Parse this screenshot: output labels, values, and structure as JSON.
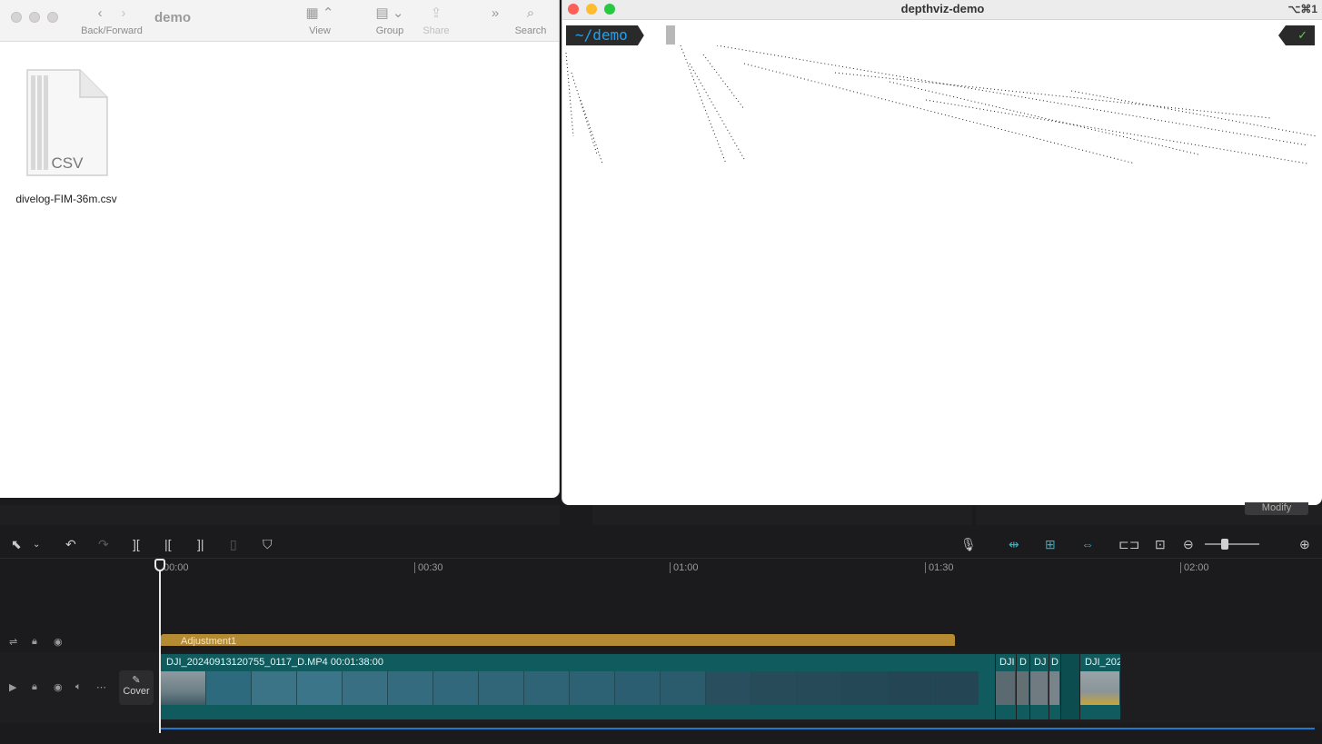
{
  "finder": {
    "title": "demo",
    "toolbar": {
      "back_forward_label": "Back/Forward",
      "view_label": "View",
      "group_label": "Group",
      "share_label": "Share",
      "search_label": "Search"
    },
    "file": {
      "icon_text": "CSV",
      "name": "divelog-FIM-36m.csv"
    }
  },
  "terminal": {
    "title": "depthviz-demo",
    "shortcut": "⌥⌘1",
    "prompt": "~/demo",
    "status": "✓"
  },
  "editor": {
    "modify_label": "Modify",
    "ruler": [
      "00:00",
      "00:30",
      "01:00",
      "01:30",
      "02:00"
    ],
    "adjustment_label": "Adjustment1",
    "cover_label": "Cover",
    "main_clip_label": "DJI_20240913120755_0117_D.MP4   00:01:38:00",
    "small_clips": [
      "DJI",
      "D",
      "DJ",
      "D",
      "DJI_202"
    ],
    "colors": {
      "clip": "#0f5b5e",
      "adjustment": "#b48a33",
      "accent": "#1fb7c9"
    }
  }
}
